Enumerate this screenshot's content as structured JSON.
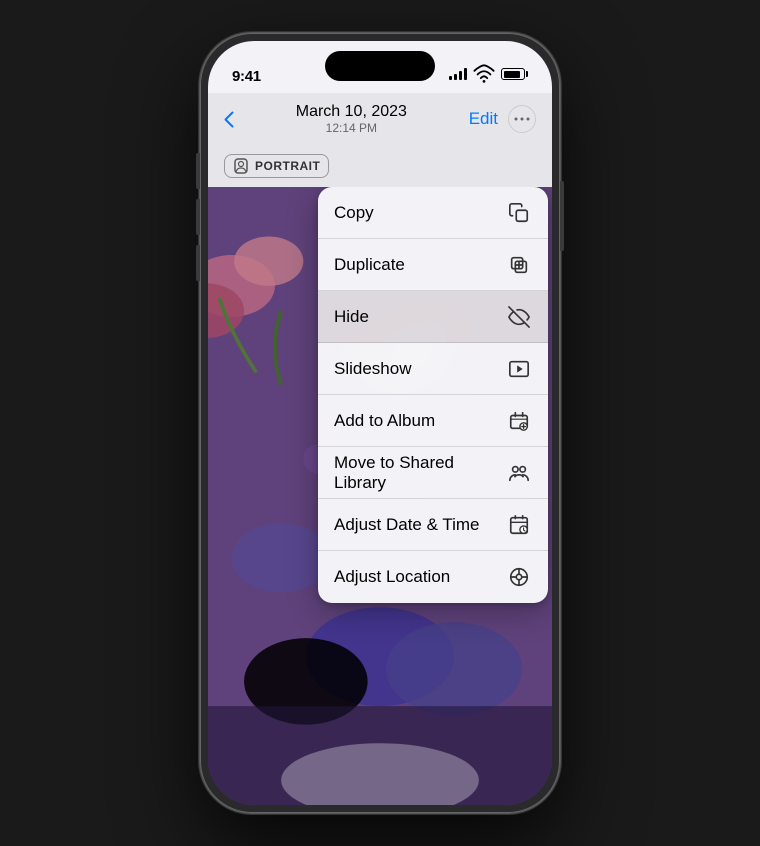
{
  "phone": {
    "status_bar": {
      "time": "9:41",
      "signal_alt": "Signal bars",
      "wifi_alt": "WiFi",
      "battery_alt": "Battery"
    },
    "nav": {
      "back_label": "<",
      "title": "March 10, 2023",
      "subtitle": "12:14 PM",
      "edit_label": "Edit",
      "more_label": "···"
    },
    "photo_bar": {
      "portrait_label": "PORTRAIT"
    },
    "context_menu": {
      "items": [
        {
          "id": "copy",
          "label": "Copy",
          "icon": "copy"
        },
        {
          "id": "duplicate",
          "label": "Duplicate",
          "icon": "duplicate"
        },
        {
          "id": "hide",
          "label": "Hide",
          "icon": "hide",
          "highlighted": true
        },
        {
          "id": "slideshow",
          "label": "Slideshow",
          "icon": "slideshow"
        },
        {
          "id": "add-to-album",
          "label": "Add to Album",
          "icon": "add-album"
        },
        {
          "id": "move-shared",
          "label": "Move to Shared Library",
          "icon": "shared-library"
        },
        {
          "id": "adjust-date",
          "label": "Adjust Date & Time",
          "icon": "calendar"
        },
        {
          "id": "adjust-location",
          "label": "Adjust Location",
          "icon": "location"
        }
      ]
    }
  }
}
